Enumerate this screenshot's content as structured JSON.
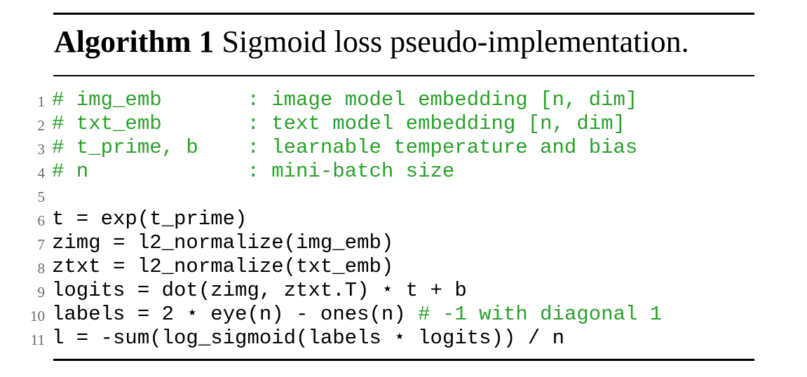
{
  "algorithm": {
    "label": "Algorithm 1",
    "caption": " Sigmoid loss pseudo-implementation."
  },
  "code_lines": [
    {
      "n": "1",
      "code": "",
      "comment": "# img_emb       : image model embedding [n, dim]"
    },
    {
      "n": "2",
      "code": "",
      "comment": "# txt_emb       : text model embedding [n, dim]"
    },
    {
      "n": "3",
      "code": "",
      "comment": "# t_prime, b    : learnable temperature and bias"
    },
    {
      "n": "4",
      "code": "",
      "comment": "# n             : mini-batch size"
    },
    {
      "n": "5",
      "code": "",
      "comment": ""
    },
    {
      "n": "6",
      "code": "t = exp(t_prime)",
      "comment": ""
    },
    {
      "n": "7",
      "code": "zimg = l2_normalize(img_emb)",
      "comment": ""
    },
    {
      "n": "8",
      "code": "ztxt = l2_normalize(txt_emb)",
      "comment": ""
    },
    {
      "n": "9",
      "code": "logits = dot(zimg, ztxt.T) ⋆ t + b",
      "comment": ""
    },
    {
      "n": "10",
      "code": "labels = 2 ⋆ eye(n) - ones(n) ",
      "comment": "# -1 with diagonal 1"
    },
    {
      "n": "11",
      "code": "l = -sum(log_sigmoid(labels ⋆ logits)) / n",
      "comment": ""
    }
  ],
  "colors": {
    "comment": "#2aa02a",
    "code": "#000000",
    "line_number": "#6a6a6a"
  }
}
